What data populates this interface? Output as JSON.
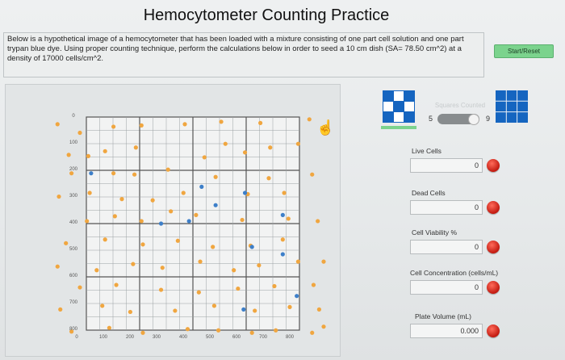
{
  "title": "Hemocytometer Counting Practice",
  "description": "Below is a hypothetical image of a hemocytometer that has been loaded with a mixture consisting of one part cell solution and one part trypan blue dye. Using proper counting technique, perform the calculations below in order to seed a 10 cm dish (SA= 78.50 cm^2) at a density of 17000 cells/cm^2.",
  "start_button": "Start/Reset",
  "squares_counted": {
    "label": "Squares Counted",
    "min": "5",
    "max": "9"
  },
  "fields": [
    {
      "label": "Live Cells",
      "value": "0"
    },
    {
      "label": "Dead Cells",
      "value": "0"
    },
    {
      "label": "Cell Viability %",
      "value": "0"
    },
    {
      "label": "Cell Concentration (cells/mL)",
      "value": "0"
    },
    {
      "label": "Plate Volume (mL)",
      "value": "0.000"
    }
  ],
  "axis": {
    "x_ticks": [
      "0",
      "100",
      "200",
      "300",
      "400",
      "500",
      "600",
      "700",
      "800"
    ],
    "y_ticks": [
      "0",
      "100",
      "200",
      "300",
      "400",
      "500",
      "600",
      "700",
      "800"
    ]
  },
  "colors": {
    "live_cell": "#f0a640",
    "dead_cell": "#3d7fc9",
    "button_green": "#7bd38d",
    "indicator_red": "#d42a1d",
    "mini_grid_blue": "#1565c0"
  },
  "cells": {
    "live": [
      [
        28,
        38
      ],
      [
        60,
        52
      ],
      [
        108,
        42
      ],
      [
        148,
        40
      ],
      [
        210,
        38
      ],
      [
        262,
        34
      ],
      [
        318,
        36
      ],
      [
        388,
        30
      ],
      [
        412,
        48
      ],
      [
        44,
        88
      ],
      [
        72,
        90
      ],
      [
        96,
        82
      ],
      [
        140,
        76
      ],
      [
        238,
        92
      ],
      [
        268,
        70
      ],
      [
        296,
        84
      ],
      [
        332,
        76
      ],
      [
        372,
        70
      ],
      [
        48,
        118
      ],
      [
        108,
        118
      ],
      [
        138,
        120
      ],
      [
        186,
        112
      ],
      [
        254,
        124
      ],
      [
        330,
        126
      ],
      [
        392,
        120
      ],
      [
        30,
        156
      ],
      [
        74,
        150
      ],
      [
        120,
        160
      ],
      [
        164,
        162
      ],
      [
        208,
        150
      ],
      [
        300,
        152
      ],
      [
        352,
        150
      ],
      [
        70,
        196
      ],
      [
        110,
        188
      ],
      [
        148,
        196
      ],
      [
        190,
        180
      ],
      [
        226,
        186
      ],
      [
        292,
        194
      ],
      [
        358,
        192
      ],
      [
        400,
        196
      ],
      [
        40,
        232
      ],
      [
        96,
        226
      ],
      [
        150,
        234
      ],
      [
        200,
        228
      ],
      [
        250,
        238
      ],
      [
        304,
        236
      ],
      [
        350,
        226
      ],
      [
        28,
        270
      ],
      [
        84,
        276
      ],
      [
        136,
        266
      ],
      [
        178,
        272
      ],
      [
        232,
        262
      ],
      [
        280,
        276
      ],
      [
        316,
        268
      ],
      [
        372,
        262
      ],
      [
        410,
        262
      ],
      [
        60,
        304
      ],
      [
        112,
        300
      ],
      [
        176,
        308
      ],
      [
        230,
        312
      ],
      [
        286,
        306
      ],
      [
        338,
        302
      ],
      [
        394,
        300
      ],
      [
        32,
        340
      ],
      [
        92,
        334
      ],
      [
        132,
        344
      ],
      [
        196,
        342
      ],
      [
        252,
        334
      ],
      [
        310,
        342
      ],
      [
        360,
        336
      ],
      [
        402,
        340
      ],
      [
        48,
        376
      ],
      [
        102,
        370
      ],
      [
        150,
        378
      ],
      [
        214,
        372
      ],
      [
        258,
        374
      ],
      [
        306,
        378
      ],
      [
        340,
        374
      ],
      [
        392,
        378
      ],
      [
        410,
        368
      ]
    ],
    "dead": [
      [
        76,
        118
      ],
      [
        234,
        140
      ],
      [
        296,
        150
      ],
      [
        216,
        196
      ],
      [
        254,
        170
      ],
      [
        350,
        186
      ],
      [
        306,
        238
      ],
      [
        350,
        250
      ],
      [
        294,
        340
      ],
      [
        176,
        200
      ],
      [
        370,
        318
      ]
    ]
  }
}
